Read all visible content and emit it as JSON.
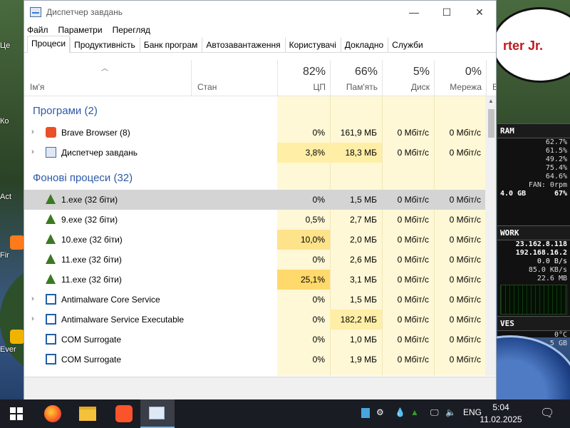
{
  "window": {
    "title": "Диспетчер завдань",
    "controls": {
      "minimize": "—",
      "maximize": "☐",
      "close": "✕"
    }
  },
  "menu": [
    "Файл",
    "Параметри",
    "Перегляд"
  ],
  "tabs": [
    "Процеси",
    "Продуктивність",
    "Банк програм",
    "Автозавантаження",
    "Користувачі",
    "Докладно",
    "Служби"
  ],
  "active_tab": "Процеси",
  "columns": {
    "name": "Ім'я",
    "status": "Стан",
    "cpu": {
      "pct": "82%",
      "label": "ЦП"
    },
    "memory": {
      "pct": "66%",
      "label": "Пам'ять"
    },
    "disk": {
      "pct": "5%",
      "label": "Диск"
    },
    "network": {
      "pct": "0%",
      "label": "Мережа"
    },
    "extra": "Е"
  },
  "groups": {
    "apps": "Програми (2)",
    "background": "Фонові процеси (32)"
  },
  "apps": [
    {
      "name": "Brave Browser (8)",
      "icon": "brave-icon",
      "cpu": "0%",
      "mem": "161,9 МБ",
      "disk": "0 Мбіт/с",
      "net": "0 Мбіт/с"
    },
    {
      "name": "Диспетчер завдань",
      "icon": "task-manager-icon",
      "cpu": "3,8%",
      "mem": "18,3 МБ",
      "disk": "0 Мбіт/с",
      "net": "0 Мбіт/с"
    }
  ],
  "background": [
    {
      "name": "1.exe (32 біти)",
      "icon": "tree-icon",
      "cpu": "0%",
      "mem": "1,5 МБ",
      "disk": "0 Мбіт/с",
      "net": "0 Мбіт/с"
    },
    {
      "name": "9.exe (32 біти)",
      "icon": "tree-icon",
      "cpu": "0,5%",
      "mem": "2,7 МБ",
      "disk": "0 Мбіт/с",
      "net": "0 Мбіт/с"
    },
    {
      "name": "10.exe (32 біти)",
      "icon": "tree-icon",
      "cpu": "10,0%",
      "mem": "2,0 МБ",
      "disk": "0 Мбіт/с",
      "net": "0 Мбіт/с"
    },
    {
      "name": "11.exe (32 біти)",
      "icon": "tree-icon",
      "cpu": "0%",
      "mem": "2,6 МБ",
      "disk": "0 Мбіт/с",
      "net": "0 Мбіт/с"
    },
    {
      "name": "11.exe (32 біти)",
      "icon": "tree-icon",
      "cpu": "25,1%",
      "mem": "3,1 МБ",
      "disk": "0 Мбіт/с",
      "net": "0 Мбіт/с"
    },
    {
      "name": "Antimalware Core Service",
      "icon": "service-icon",
      "cpu": "0%",
      "mem": "1,5 МБ",
      "disk": "0 Мбіт/с",
      "net": "0 Мбіт/с"
    },
    {
      "name": "Antimalware Service Executable",
      "icon": "service-icon",
      "cpu": "0%",
      "mem": "182,2 МБ",
      "disk": "0 Мбіт/с",
      "net": "0 Мбіт/с"
    },
    {
      "name": "COM Surrogate",
      "icon": "service-icon",
      "cpu": "0%",
      "mem": "1,0 МБ",
      "disk": "0 Мбіт/с",
      "net": "0 Мбіт/с"
    },
    {
      "name": "COM Surrogate",
      "icon": "service-icon",
      "cpu": "0%",
      "mem": "1,9 МБ",
      "disk": "0 Мбіт/с",
      "net": "0 Мбіт/с"
    }
  ],
  "desktop": {
    "bubble_text": "rter Jr.",
    "icon_labels": [
      "Це",
      "Ко",
      "Act",
      "Fir",
      "Ever"
    ]
  },
  "widget": {
    "ram_title": "RAM",
    "ram_rows": [
      "62.7%",
      "61.5%",
      "49.2%",
      "75.4%",
      "64.6%",
      "FAN: 0rpm"
    ],
    "ram_total_left": "4.0 GB",
    "ram_total_right": "67%",
    "network_title": "WORK",
    "ip1": "23.162.8.118",
    "ip2": "192.168.16.2",
    "net_rows": [
      "0.0 B/s",
      "85.0 KB/s",
      "22.6 MB"
    ],
    "drives_title": "VES",
    "drive_rows": [
      "0°C",
      "5 GB"
    ]
  },
  "taskbar": {
    "language": "ENG",
    "time": "5:04",
    "date": "11.02.2025"
  },
  "colors": {
    "group_header": "#2d5aa8",
    "heat_light": "#fff8d6",
    "heat_mid": "#ffeea6",
    "heat_high": "#ffd96b",
    "selected_row": "#d4d4d4"
  }
}
